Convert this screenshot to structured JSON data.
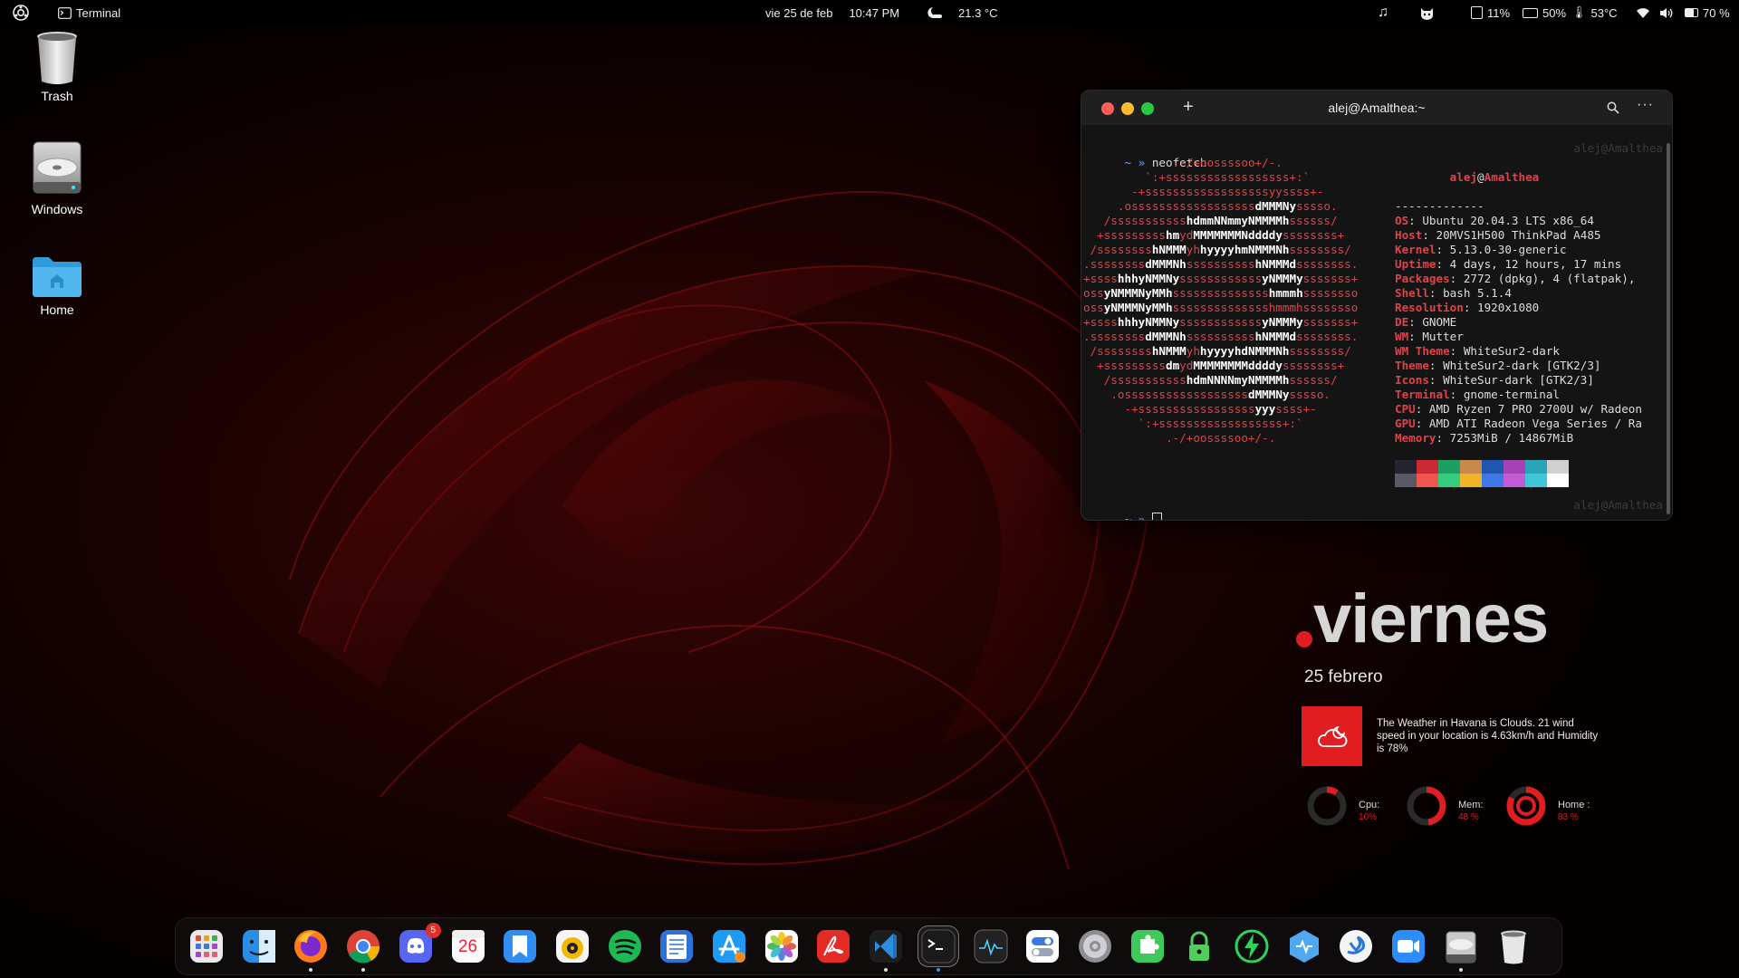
{
  "topbar": {
    "activities_icon": "ubuntu-logo-icon",
    "app_name": "Terminal",
    "date": "vie 25 de feb",
    "time": "10:47 PM",
    "weather_temp": "21.3 °C",
    "disk": "11%",
    "battery_health": "50%",
    "cpu_temp": "53°C",
    "battery": "70 %"
  },
  "desktop": {
    "trash_label": "Trash",
    "windows_label": "Windows",
    "home_label": "Home"
  },
  "terminal": {
    "title": "alej@Amalthea:~",
    "prompt": "~ »",
    "command": "neofetch",
    "right_prompt": "alej@Amalthea",
    "user": "alej",
    "at": "@",
    "host": "Amalthea",
    "separator": "-------------",
    "info": [
      {
        "key": "OS",
        "value": "Ubuntu 20.04.3 LTS x86_64"
      },
      {
        "key": "Host",
        "value": "20MVS1H500 ThinkPad A485"
      },
      {
        "key": "Kernel",
        "value": "5.13.0-30-generic"
      },
      {
        "key": "Uptime",
        "value": "4 days, 12 hours, 17 mins"
      },
      {
        "key": "Packages",
        "value": "2772 (dpkg), 4 (flatpak),"
      },
      {
        "key": "Shell",
        "value": "bash 5.1.4"
      },
      {
        "key": "Resolution",
        "value": "1920x1080"
      },
      {
        "key": "DE",
        "value": "GNOME"
      },
      {
        "key": "WM",
        "value": "Mutter"
      },
      {
        "key": "WM Theme",
        "value": "WhiteSur2-dark"
      },
      {
        "key": "Theme",
        "value": "WhiteSur2-dark [GTK2/3]"
      },
      {
        "key": "Icons",
        "value": "WhiteSur-dark [GTK2/3]"
      },
      {
        "key": "Terminal",
        "value": "gnome-terminal"
      },
      {
        "key": "CPU",
        "value": "AMD Ryzen 7 PRO 2700U w/ Radeon"
      },
      {
        "key": "GPU",
        "value": "AMD ATI Radeon Vega Series / Ra"
      },
      {
        "key": "Memory",
        "value": "7253MiB / 14867MiB"
      }
    ],
    "palette_top": [
      "#242430",
      "#cc2a33",
      "#1f9e63",
      "#c88a4a",
      "#1f56b0",
      "#a742b6",
      "#2aa5b8",
      "#d0d0d0"
    ],
    "palette_bottom": [
      "#5a5a66",
      "#f0564f",
      "#36cc7d",
      "#f0b429",
      "#3c78e6",
      "#c25cd6",
      "#3fc6d9",
      "#ffffff"
    ],
    "ascii": [
      [
        [
          "r",
          "             .-/+oossssoo+/-."
        ]
      ],
      [
        [
          "r",
          "         `:+ssssssssssssssssss+:`"
        ]
      ],
      [
        [
          "r",
          "       -+ssssssssssssssssssyyssss+-"
        ]
      ],
      [
        [
          "r",
          "     .ossssssssssssssssss"
        ],
        [
          "w",
          "dMMMNy"
        ],
        [
          "r",
          "sssso."
        ]
      ],
      [
        [
          "r",
          "   /sssssssssss"
        ],
        [
          "w",
          "hdmmNNmmyNMMMMh"
        ],
        [
          "r",
          "ssssss/"
        ]
      ],
      [
        [
          "r",
          "  +sssssssss"
        ],
        [
          "w",
          "hm"
        ],
        [
          "r",
          "yd"
        ],
        [
          "w",
          "MMMMMMMNddddy"
        ],
        [
          "r",
          "ssssssss+"
        ]
      ],
      [
        [
          "r",
          " /ssssssss"
        ],
        [
          "w",
          "hNMMM"
        ],
        [
          "r",
          "yh"
        ],
        [
          "w",
          "hyyyyhmNMMMNh"
        ],
        [
          "r",
          "ssssssss/"
        ]
      ],
      [
        [
          "r",
          ".ssssssss"
        ],
        [
          "w",
          "dMMMNh"
        ],
        [
          "r",
          "ssssssssss"
        ],
        [
          "w",
          "hNMMMd"
        ],
        [
          "r",
          "ssssssss."
        ]
      ],
      [
        [
          "r",
          "+ssss"
        ],
        [
          "w",
          "hhhyNMMNy"
        ],
        [
          "r",
          "ssssssssssss"
        ],
        [
          "w",
          "yNMMMy"
        ],
        [
          "r",
          "sssssss+"
        ]
      ],
      [
        [
          "r",
          "oss"
        ],
        [
          "w",
          "yNMMMNyMMh"
        ],
        [
          "r",
          "ssssssssssssss"
        ],
        [
          "w",
          "hmmmh"
        ],
        [
          "r",
          "ssssssso"
        ]
      ],
      [
        [
          "r",
          "oss"
        ],
        [
          "w",
          "yNMMMNyMMh"
        ],
        [
          "r",
          "sssssssssssssshmmmhssssssso"
        ]
      ],
      [
        [
          "r",
          "+ssss"
        ],
        [
          "w",
          "hhhyNMMNy"
        ],
        [
          "r",
          "ssssssssssss"
        ],
        [
          "w",
          "yNMMMy"
        ],
        [
          "r",
          "sssssss+"
        ]
      ],
      [
        [
          "r",
          ".ssssssss"
        ],
        [
          "w",
          "dMMMNh"
        ],
        [
          "r",
          "ssssssssss"
        ],
        [
          "w",
          "hNMMMd"
        ],
        [
          "r",
          "ssssssss."
        ]
      ],
      [
        [
          "r",
          " /ssssssss"
        ],
        [
          "w",
          "hNMMM"
        ],
        [
          "r",
          "yh"
        ],
        [
          "w",
          "hyyyyhdNMMMNh"
        ],
        [
          "r",
          "ssssssss/"
        ]
      ],
      [
        [
          "r",
          "  +sssssssss"
        ],
        [
          "w",
          "dm"
        ],
        [
          "r",
          "yd"
        ],
        [
          "w",
          "MMMMMMMMddddy"
        ],
        [
          "r",
          "ssssssss+"
        ]
      ],
      [
        [
          "r",
          "   /sssssssssss"
        ],
        [
          "w",
          "hdmNNNNmyNMMMMh"
        ],
        [
          "r",
          "ssssss/"
        ]
      ],
      [
        [
          "r",
          "    .ossssssssssssssssss"
        ],
        [
          "w",
          "dMMMNy"
        ],
        [
          "r",
          "sssso."
        ]
      ],
      [
        [
          "r",
          "      -+sssssssssssssssss"
        ],
        [
          "w",
          "yyy"
        ],
        [
          "r",
          "ssss+-"
        ]
      ],
      [
        [
          "r",
          "        `:+ssssssssssssssssss+:`"
        ]
      ],
      [
        [
          "r",
          "            .-/+oossssoo+/-."
        ]
      ]
    ]
  },
  "conky": {
    "day": "viernes",
    "date": "25 febrero",
    "weather_text": "The Weather in Havana is Clouds. 21 wind speed in your location is 4.63km/h and Humidity is 78%",
    "accent": "#e01d20",
    "rings": [
      {
        "label": "Cpu:",
        "value": "10%",
        "fraction": 0.1
      },
      {
        "label": "Mem:",
        "value": "48 %",
        "fraction": 0.48
      },
      {
        "label": "Home :",
        "value": "83 %",
        "fraction": 0.83
      }
    ]
  },
  "dock": {
    "apps": [
      {
        "name": "launchpad-icon",
        "running": false
      },
      {
        "name": "finder-icon",
        "running": false
      },
      {
        "name": "firefox-icon",
        "running": true
      },
      {
        "name": "chrome-icon",
        "running": true
      },
      {
        "name": "discord-icon",
        "running": false,
        "badge": "5"
      },
      {
        "name": "calendar-icon",
        "running": false,
        "text": "26"
      },
      {
        "name": "books-icon",
        "running": false
      },
      {
        "name": "rhythmbox-icon",
        "running": false
      },
      {
        "name": "spotify-icon",
        "running": false
      },
      {
        "name": "text-editor-icon",
        "running": false
      },
      {
        "name": "app-store-icon",
        "running": false
      },
      {
        "name": "photos-icon",
        "running": false
      },
      {
        "name": "pdf-reader-icon",
        "running": false
      },
      {
        "name": "vscode-icon",
        "running": true
      },
      {
        "name": "terminal-icon",
        "running": true,
        "active": true
      },
      {
        "name": "system-monitor-icon",
        "running": false
      },
      {
        "name": "toggles-icon",
        "running": false
      },
      {
        "name": "settings-icon",
        "running": false
      },
      {
        "name": "extensions-icon",
        "running": false
      },
      {
        "name": "vpn-lock-icon",
        "running": false
      },
      {
        "name": "power-icon",
        "running": false
      },
      {
        "name": "hex-app-icon",
        "running": false
      },
      {
        "name": "swift-app-icon",
        "running": false
      },
      {
        "name": "zoom-icon",
        "running": false
      },
      {
        "name": "drive-icon",
        "running": true
      },
      {
        "name": "trash-icon",
        "running": false
      }
    ]
  }
}
